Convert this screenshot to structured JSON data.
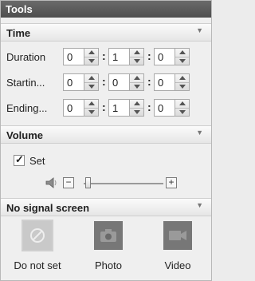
{
  "panel": {
    "title": "Tools"
  },
  "time": {
    "header": "Time",
    "rows": [
      {
        "label": "Duration",
        "hours": "0",
        "minutes": "1",
        "seconds": "0"
      },
      {
        "label": "Startin...",
        "hours": "0",
        "minutes": "0",
        "seconds": "0"
      },
      {
        "label": "Ending...",
        "hours": "0",
        "minutes": "1",
        "seconds": "0"
      }
    ],
    "separator": ":"
  },
  "volume": {
    "header": "Volume",
    "set_label": "Set",
    "set_checked": true,
    "minus_label": "−",
    "plus_label": "+",
    "level": 0.02
  },
  "no_signal": {
    "header": "No signal screen",
    "options": [
      {
        "label": "Do not set",
        "icon": "no-entry-icon",
        "selected": true
      },
      {
        "label": "Photo",
        "icon": "camera-icon",
        "selected": false
      },
      {
        "label": "Video",
        "icon": "video-camera-icon",
        "selected": false
      }
    ]
  },
  "icons": {
    "collapse": "chevron-down-icon",
    "speaker": "speaker-icon"
  },
  "colors": {
    "titlebar": "#5a5a5a",
    "tile": "#777777",
    "tile_selected": "#c9c9c9"
  }
}
